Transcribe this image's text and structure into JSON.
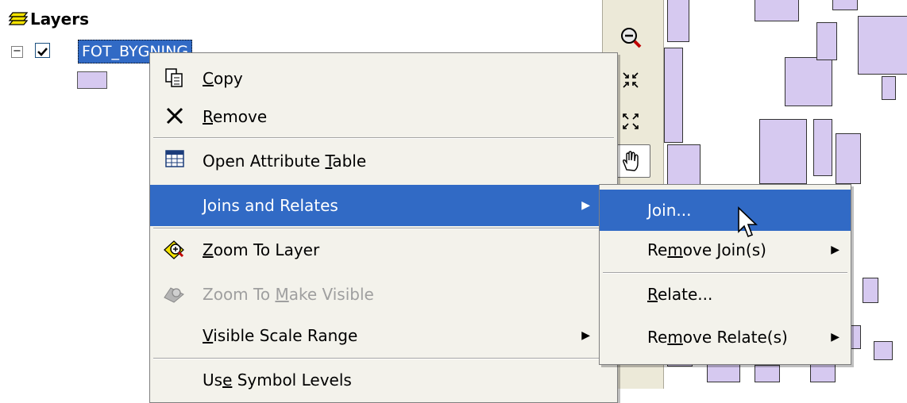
{
  "toc": {
    "title": "Layers",
    "layer_name": "FOT_BYGNING",
    "expander": "−"
  },
  "context_menu": {
    "items": [
      {
        "label_pre": "",
        "label_ul": "C",
        "label_post": "opy"
      },
      {
        "label_pre": "",
        "label_ul": "R",
        "label_post": "emove"
      },
      {
        "label_pre": "Open Attribute ",
        "label_ul": "T",
        "label_post": "able"
      },
      {
        "label_pre": "",
        "label_ul": "J",
        "label_post": "oins and Relates"
      },
      {
        "label_pre": "",
        "label_ul": "Z",
        "label_post": "oom To Layer"
      },
      {
        "label_pre": "Zoom To ",
        "label_ul": "M",
        "label_post": "ake Visible"
      },
      {
        "label_pre": "",
        "label_ul": "V",
        "label_post": "isible Scale Range"
      },
      {
        "label_pre": "Us",
        "label_ul": "e",
        "label_post": " Symbol Levels"
      }
    ]
  },
  "submenu": {
    "items": [
      {
        "label_pre": "",
        "label_ul": "J",
        "label_post": "oin..."
      },
      {
        "label_pre": "Re",
        "label_ul": "m",
        "label_post": "ove Join(s)"
      },
      {
        "label_pre": "",
        "label_ul": "R",
        "label_post": "elate..."
      },
      {
        "label_pre": "Re",
        "label_ul": "m",
        "label_post": "ove Relate(s)"
      }
    ]
  },
  "colors": {
    "highlight": "#316ac5",
    "menu_bg": "#f3f2eb",
    "building_fill": "#d6c9f0"
  },
  "icons": [
    "layers-icon",
    "copy-icon",
    "remove-x-icon",
    "attribute-table-icon",
    "zoom-to-layer-icon",
    "zoom-to-make-visible-icon",
    "zoom-out-icon",
    "fixed-zoom-in-icon",
    "fixed-zoom-out-icon",
    "pan-hand-icon",
    "submenu-arrow-icon",
    "mouse-pointer-icon"
  ]
}
